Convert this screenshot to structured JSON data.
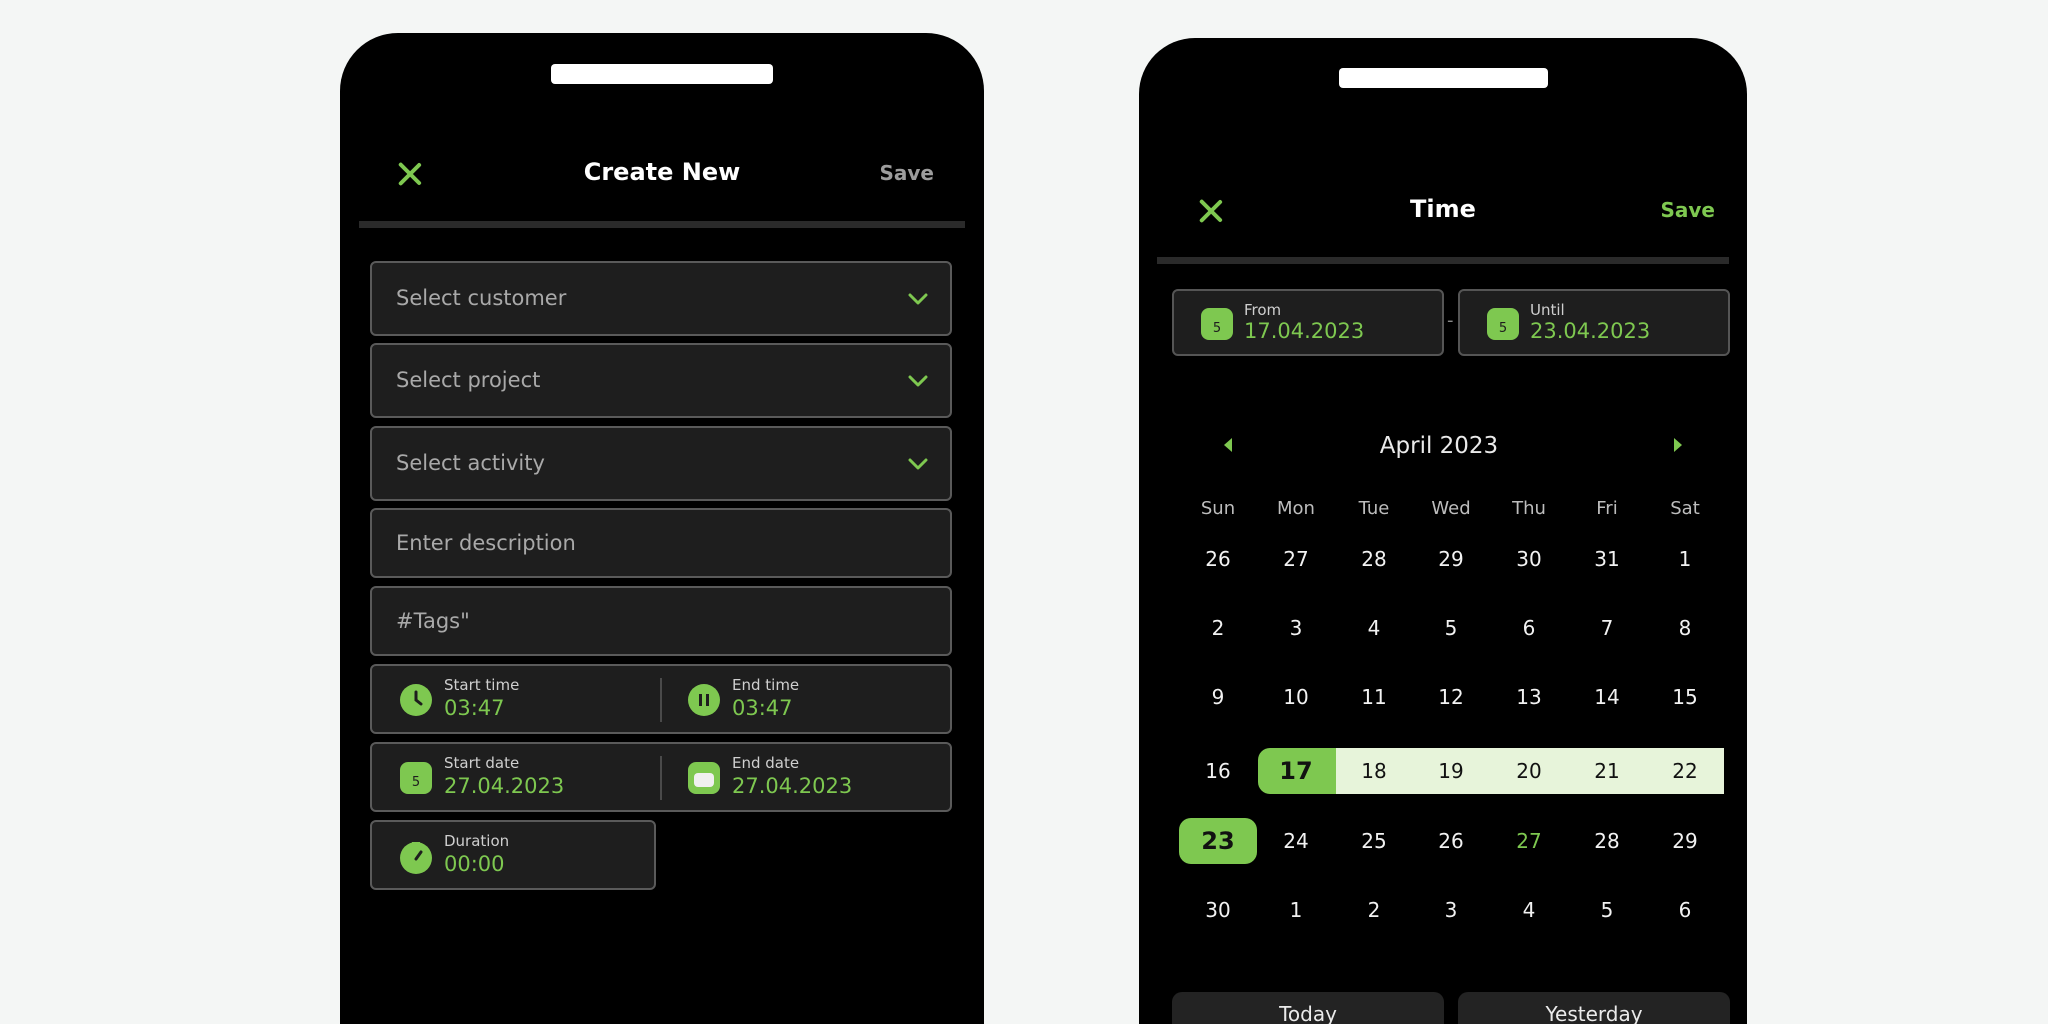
{
  "create_new": {
    "title": "Create New",
    "save_label": "Save",
    "fields": {
      "customer_placeholder": "Select customer",
      "project_placeholder": "Select project",
      "activity_placeholder": "Select activity",
      "description_placeholder": "Enter description",
      "tags_placeholder": "#Tags\""
    },
    "start_time": {
      "label": "Start time",
      "value": "03:47"
    },
    "end_time": {
      "label": "End time",
      "value": "03:47"
    },
    "start_date": {
      "label": "Start date",
      "value": "27.04.2023"
    },
    "end_date": {
      "label": "End date",
      "value": "27.04.2023"
    },
    "duration": {
      "label": "Duration",
      "value": "00:00"
    },
    "calendar_badge": "5"
  },
  "time": {
    "title": "Time",
    "save_label": "Save",
    "from": {
      "label": "From",
      "value": "17.04.2023"
    },
    "until": {
      "label": "Until",
      "value": "23.04.2023"
    },
    "separator": "-",
    "calendar_badge": "5",
    "month_label": "April 2023",
    "weekdays": [
      "Sun",
      "Mon",
      "Tue",
      "Wed",
      "Thu",
      "Fri",
      "Sat"
    ],
    "weeks": [
      [
        "26",
        "27",
        "28",
        "29",
        "30",
        "31",
        "1"
      ],
      [
        "2",
        "3",
        "4",
        "5",
        "6",
        "7",
        "8"
      ],
      [
        "9",
        "10",
        "11",
        "12",
        "13",
        "14",
        "15"
      ],
      [
        "16",
        "17",
        "18",
        "19",
        "20",
        "21",
        "22"
      ],
      [
        "23",
        "24",
        "25",
        "26",
        "27",
        "28",
        "29"
      ],
      [
        "30",
        "1",
        "2",
        "3",
        "4",
        "5",
        "6"
      ]
    ],
    "today_label": "Today",
    "yesterday_label": "Yesterday"
  },
  "colors": {
    "accent": "#7ec850",
    "range": "#e7f4da",
    "field_bg": "#1e1e1e",
    "page_bg": "#f4f6f5"
  },
  "icons": [
    "close-icon",
    "chevron-down-icon",
    "clock-icon",
    "pause-icon",
    "calendar-icon",
    "stopwatch-icon",
    "arrow-left-icon",
    "arrow-right-icon"
  ]
}
